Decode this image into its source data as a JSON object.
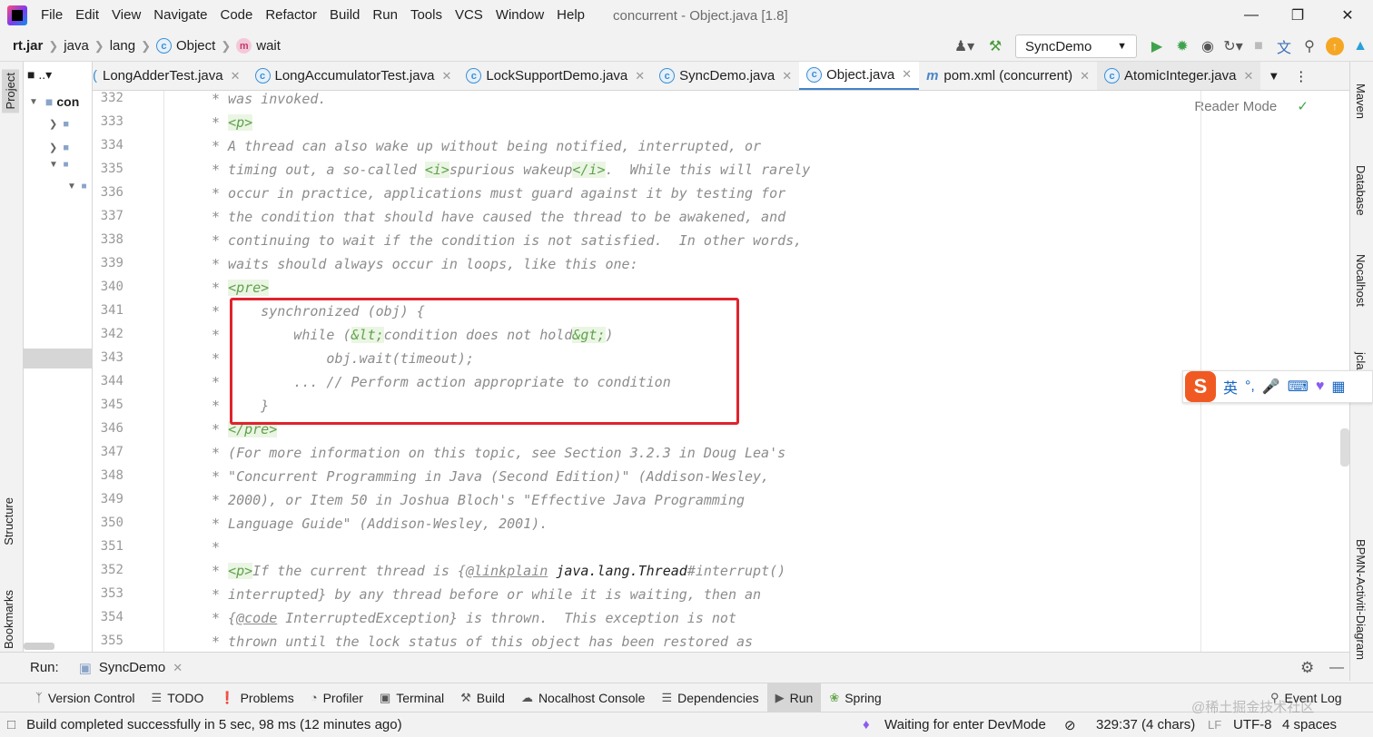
{
  "menubar": {
    "items": [
      "File",
      "Edit",
      "View",
      "Navigate",
      "Code",
      "Refactor",
      "Build",
      "Run",
      "Tools",
      "VCS",
      "Window",
      "Help"
    ],
    "window_title": "concurrent - Object.java [1.8]"
  },
  "breadcrumb": [
    "rt.jar",
    "java",
    "lang",
    "Object",
    "wait"
  ],
  "toolbar": {
    "run_config": "SyncDemo"
  },
  "left_panel": {
    "project_tab": "Project",
    "structure_tab": "Structure",
    "bookmarks_tab": "Bookmarks",
    "tree_root": "con"
  },
  "tabs": [
    {
      "label": "LongAdderTest.java"
    },
    {
      "label": "LongAccumulatorTest.java"
    },
    {
      "label": "LockSupportDemo.java"
    },
    {
      "label": "SyncDemo.java"
    },
    {
      "label": "Object.java"
    },
    {
      "label": "pom.xml (concurrent)"
    },
    {
      "label": "AtomicInteger.java"
    }
  ],
  "editor": {
    "reader_mode": "Reader Mode",
    "line_numbers": [
      "332",
      "333",
      "334",
      "335",
      "336",
      "337",
      "338",
      "339",
      "340",
      "341",
      "342",
      "343",
      "344",
      "345",
      "346",
      "347",
      "348",
      "349",
      "350",
      "351",
      "352",
      "353",
      "354",
      "355"
    ]
  },
  "right_panel": {
    "tabs": [
      "Maven",
      "Database",
      "Nocalhost",
      "jcla",
      "BPMN-Activiti-Diagram"
    ]
  },
  "ime": {
    "lang": "英"
  },
  "run_bar": {
    "label": "Run:",
    "tab": "SyncDemo"
  },
  "tool_windows": [
    "Version Control",
    "TODO",
    "Problems",
    "Profiler",
    "Terminal",
    "Build",
    "Nocalhost Console",
    "Dependencies",
    "Run",
    "Spring",
    "Event Log"
  ],
  "status": {
    "message": "Build completed successfully in 5 sec, 98 ms (12 minutes ago)",
    "devmode": "Waiting for enter DevMode",
    "position": "329:37 (4 chars)",
    "line_sep": "LF",
    "encoding": "UTF-8",
    "indent": "4 spaces"
  },
  "watermark": "@稀土掘金技术社区",
  "colors": {
    "highlight_border": "#e0232d",
    "active_tab_underline": "#4083c9",
    "comment": "#8c8c8c",
    "tag_bg": "#ebf5e4"
  }
}
